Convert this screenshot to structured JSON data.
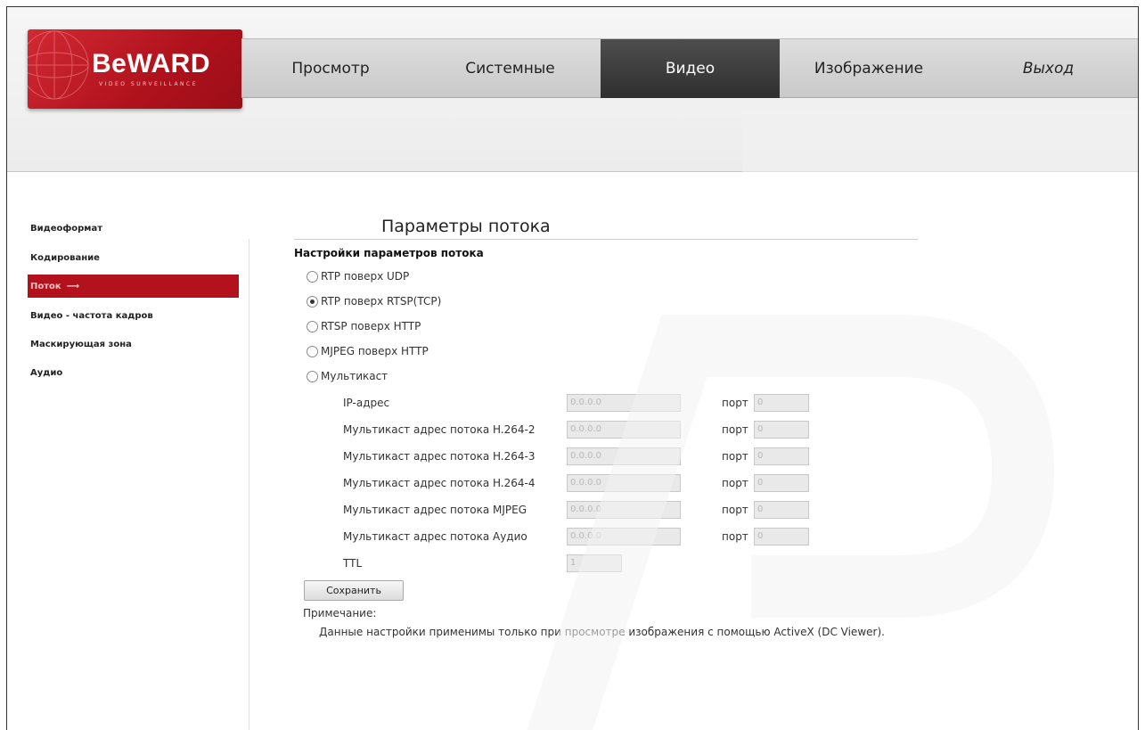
{
  "logo": {
    "text": "BeWARD",
    "subtitle": "VIDEO SURVEILLANCE"
  },
  "nav": {
    "items": [
      {
        "label": "Просмотр"
      },
      {
        "label": "Системные"
      },
      {
        "label": "Видео"
      },
      {
        "label": "Изображение"
      },
      {
        "label": "Выход"
      }
    ],
    "active": "Видео"
  },
  "sidebar": {
    "items": [
      {
        "label": "Видеоформат"
      },
      {
        "label": "Кодирование"
      },
      {
        "label": "Поток"
      },
      {
        "label": "Видео - частота кадров"
      },
      {
        "label": "Маскирующая зона"
      },
      {
        "label": "Аудио"
      }
    ],
    "active": "Поток",
    "active_arrow": "⟶"
  },
  "main": {
    "title": "Параметры потока",
    "section_title": "Настройки параметров потока",
    "stream_options": [
      {
        "label": "RTP поверх UDP",
        "checked": false
      },
      {
        "label": "RTP поверх RTSP(TCP)",
        "checked": true
      },
      {
        "label": "RTSP поверх HTTP",
        "checked": false
      },
      {
        "label": "MJPEG поверх HTTP",
        "checked": false
      },
      {
        "label": "Мультикаст",
        "checked": false
      }
    ],
    "multicast": {
      "port_label": "порт",
      "rows": [
        {
          "label": "IP-адрес",
          "address": "0.0.0.0",
          "port": "0"
        },
        {
          "label": "Мультикаст адрес потока H.264-2",
          "address": "0.0.0.0",
          "port": "0"
        },
        {
          "label": "Мультикаст адрес потока H.264-3",
          "address": "0.0.0.0",
          "port": "0"
        },
        {
          "label": "Мультикаст адрес потока H.264-4",
          "address": "0.0.0.0",
          "port": "0"
        },
        {
          "label": "Мультикаст адрес потока MJPEG",
          "address": "0.0.0.0",
          "port": "0"
        },
        {
          "label": "Мультикаст адрес потока Аудио",
          "address": "0.0.0.0",
          "port": "0"
        }
      ],
      "ttl_label": "TTL",
      "ttl_value": "1"
    },
    "save_label": "Сохранить",
    "note_label": "Примечание:",
    "note_text": "Данные настройки применимы только при просмотре изображения с помощью ActiveX (DC Viewer)."
  },
  "colors": {
    "brand_red": "#b3121c",
    "nav_active": "#3a3a3a"
  }
}
